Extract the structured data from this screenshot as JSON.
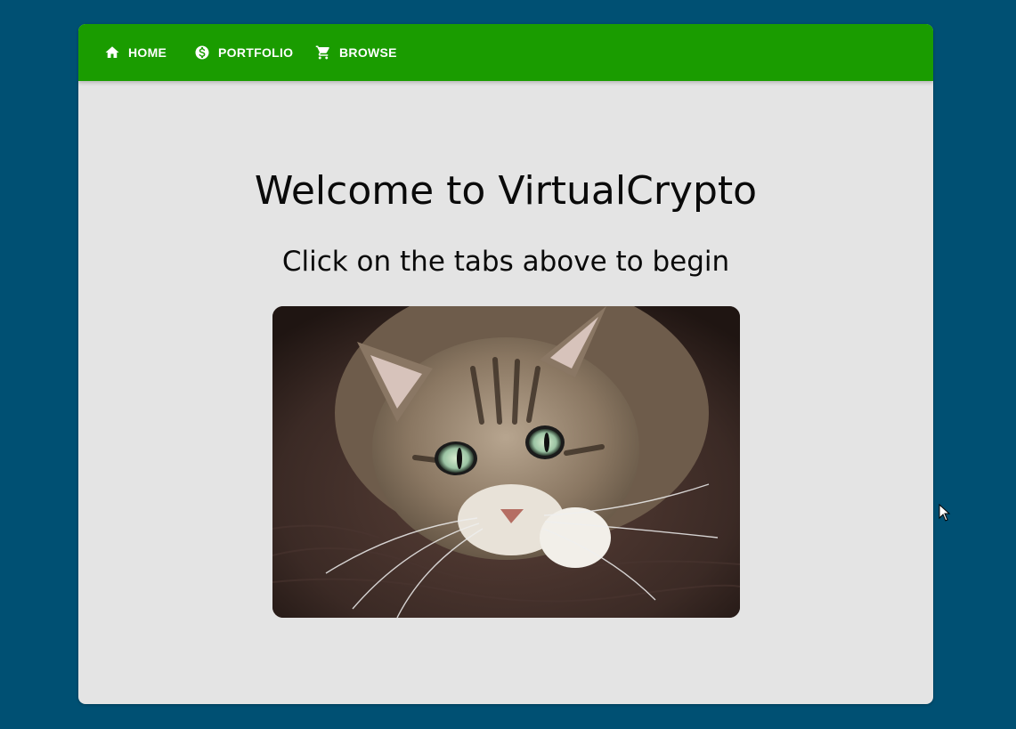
{
  "nav": {
    "tabs": [
      {
        "label": "HOME",
        "icon": "home-icon"
      },
      {
        "label": "PORTFOLIO",
        "icon": "dollar-circle-icon"
      },
      {
        "label": "BROWSE",
        "icon": "cart-icon"
      }
    ]
  },
  "main": {
    "title": "Welcome to VirtualCrypto",
    "subtitle": "Click on the tabs above to begin",
    "image": {
      "subject": "cat-photo"
    }
  },
  "colors": {
    "page_background": "#005073",
    "navbar": "#1a9c00",
    "card": "#e4e4e4",
    "text": "#0a0a0a"
  }
}
